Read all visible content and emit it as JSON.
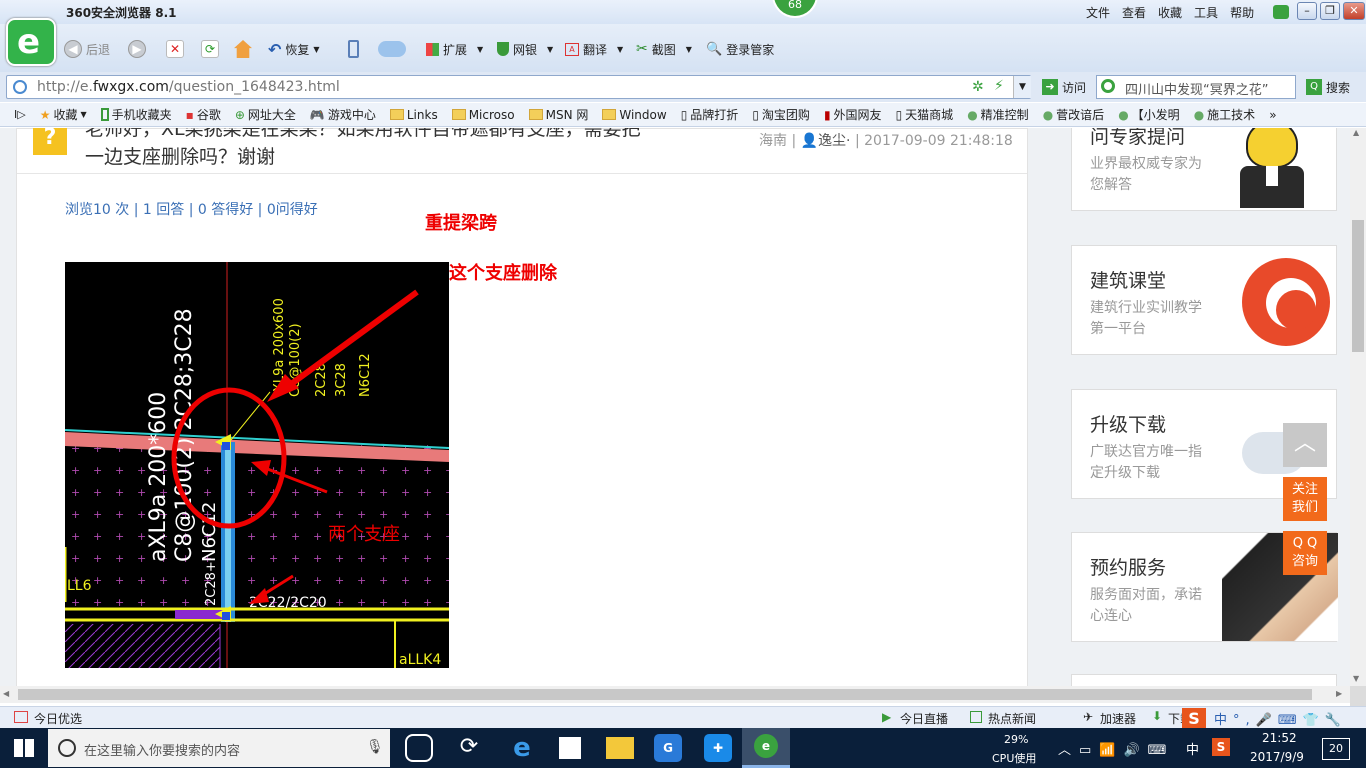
{
  "browser": {
    "title": "360安全浏览器 8.1",
    "badge": "68",
    "menu": [
      "文件",
      "查看",
      "收藏",
      "工具",
      "帮助"
    ]
  },
  "toolbar": {
    "back": "后退",
    "restore": "恢复",
    "ext": "扩展",
    "bank": "网银",
    "translate": "翻译",
    "screenshot": "截图",
    "login": "登录管家"
  },
  "address": {
    "url_prefix": "http://e.",
    "url_domain": "fwxgx.com",
    "url_path": "/question_1648423.html",
    "go": "访问",
    "search_text": "四川山中发现“冥界之花”",
    "search_btn": "搜索"
  },
  "favorites": [
    "收藏",
    "手机收藏夹",
    "谷歌",
    "网址大全",
    "游戏中心",
    "Links",
    "Microso",
    "MSN 网",
    "Window",
    "品牌打折",
    "淘宝团购",
    "外国网友",
    "天猫商城",
    "精准控制",
    "菅改谙后",
    "【小发明",
    "施工技术"
  ],
  "question": {
    "title_line1": "老师好，XL梁挑梁是在某某？如果用软件自带遮都有支座，需要把",
    "title_line2": "一边支座删除吗？谢谢",
    "meta_region": "海南",
    "meta_user": "逸尘·",
    "meta_time": "2017-09-09 21:48:18",
    "stats": "浏览10 次 | 1 回答 | 0 答得好 | 0问得好"
  },
  "annotations": {
    "a1": "重提梁跨",
    "a2": "把这个支座删除",
    "a3": "两个支座"
  },
  "cad": {
    "t1": "aXL9a 200*600",
    "t2": "C8@100(2) 2C28;3C28",
    "t3": "N6C12",
    "t4": "XL9a 200x600",
    "t5": "C8@100(2)",
    "t6": "2C28",
    "t7": "3C28",
    "t8": "N6C12",
    "t9": "LL6",
    "t10": "2C22/2C20",
    "t11": "aLLK4",
    "t12": "2C28+"
  },
  "sidebar": [
    {
      "title": "问专家提问",
      "desc": "业界最权威专家为您解答"
    },
    {
      "title": "建筑课堂",
      "desc": "建筑行业实训教学第一平台"
    },
    {
      "title": "升级下载",
      "desc": "广联达官方唯一指定升级下载"
    },
    {
      "title": "预约服务",
      "desc": "服务面对面，承诺心连心"
    }
  ],
  "float": {
    "follow": "关注我们",
    "qq": "Q Q咨询"
  },
  "status": {
    "left": "今日优选",
    "live": "今日直播",
    "news": "热点新闻",
    "speed": "加速器",
    "down": "下载"
  },
  "taskbar": {
    "search": "在这里输入你要搜索的内容",
    "cpu_pct": "29%",
    "cpu_label": "CPU使用",
    "ime": "中",
    "time": "21:52",
    "date": "2017/9/9",
    "notif": "20"
  }
}
